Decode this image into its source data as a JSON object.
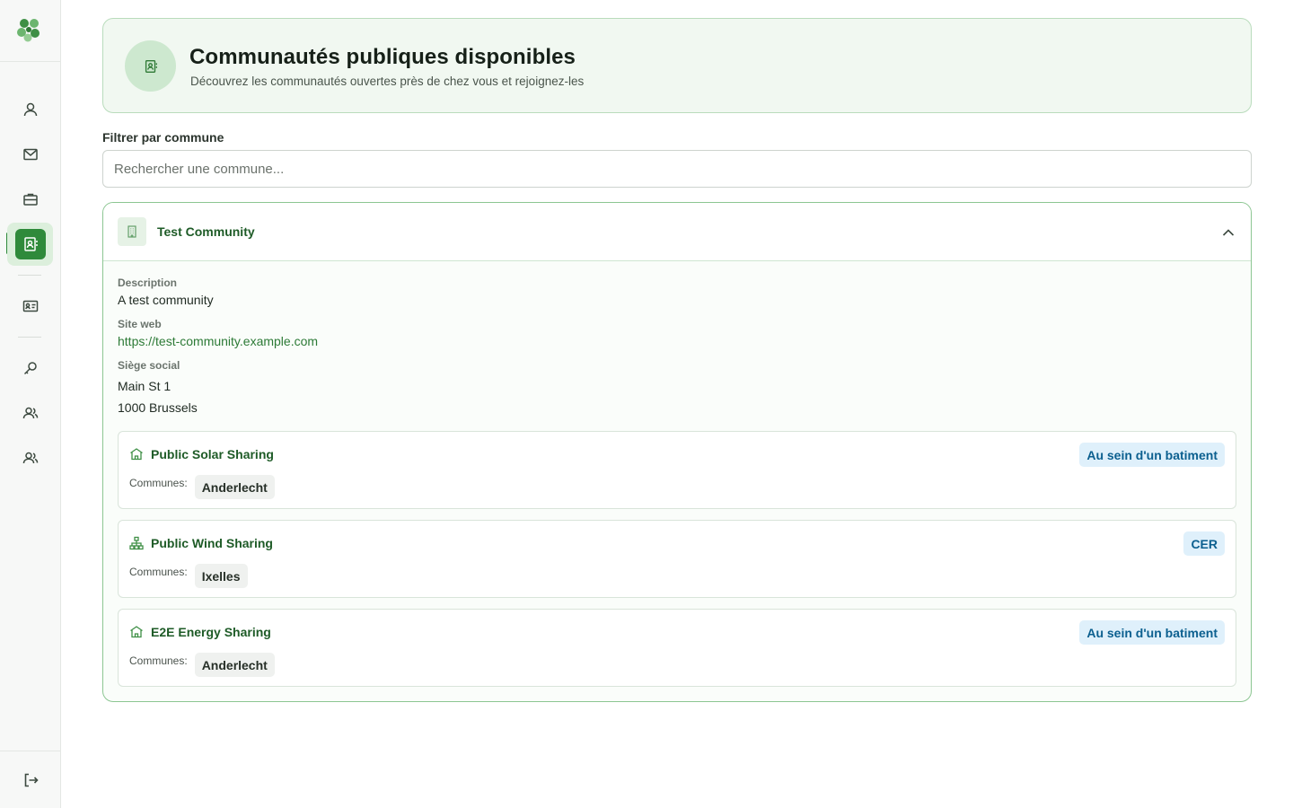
{
  "sidebar": {
    "logo": "clover-logo",
    "items": [
      {
        "name": "profile",
        "icon": "user-icon"
      },
      {
        "name": "messages",
        "icon": "mail-icon"
      },
      {
        "name": "work",
        "icon": "briefcase-icon"
      },
      {
        "name": "communities",
        "icon": "contact-book-icon",
        "active": true
      },
      {
        "name": "id-card",
        "icon": "id-card-icon"
      },
      {
        "name": "keys",
        "icon": "key-icon"
      },
      {
        "name": "members",
        "icon": "users-icon"
      },
      {
        "name": "groups",
        "icon": "users-icon"
      }
    ],
    "logout_icon": "logout-icon"
  },
  "header": {
    "title": "Communautés publiques disponibles",
    "subtitle": "Découvrez les communautés ouvertes près de chez vous et rejoignez-les"
  },
  "filter": {
    "label": "Filtrer par commune",
    "placeholder": "Rechercher une commune...",
    "value": ""
  },
  "community": {
    "name": "Test Community",
    "expanded": true,
    "description_label": "Description",
    "description": "A test community",
    "website_label": "Site web",
    "website": "https://test-community.example.com",
    "hq_label": "Siège social",
    "hq_line1": "Main St 1",
    "hq_line2": "1000 Brussels",
    "sharings": [
      {
        "name": "Public Solar Sharing",
        "icon": "building-icon",
        "badge": "Au sein d'un batiment",
        "communes_label": "Communes:",
        "communes": [
          "Anderlecht"
        ]
      },
      {
        "name": "Public Wind Sharing",
        "icon": "network-icon",
        "badge": "CER",
        "communes_label": "Communes:",
        "communes": [
          "Ixelles"
        ]
      },
      {
        "name": "E2E Energy Sharing",
        "icon": "building-icon",
        "badge": "Au sein d'un batiment",
        "communes_label": "Communes:",
        "communes": [
          "Anderlecht"
        ]
      }
    ]
  },
  "colors": {
    "accent": "#2f8a3b",
    "header_bg": "#f1f8f1",
    "badge_bg": "#dff0fb",
    "badge_text": "#0b5f8f"
  }
}
